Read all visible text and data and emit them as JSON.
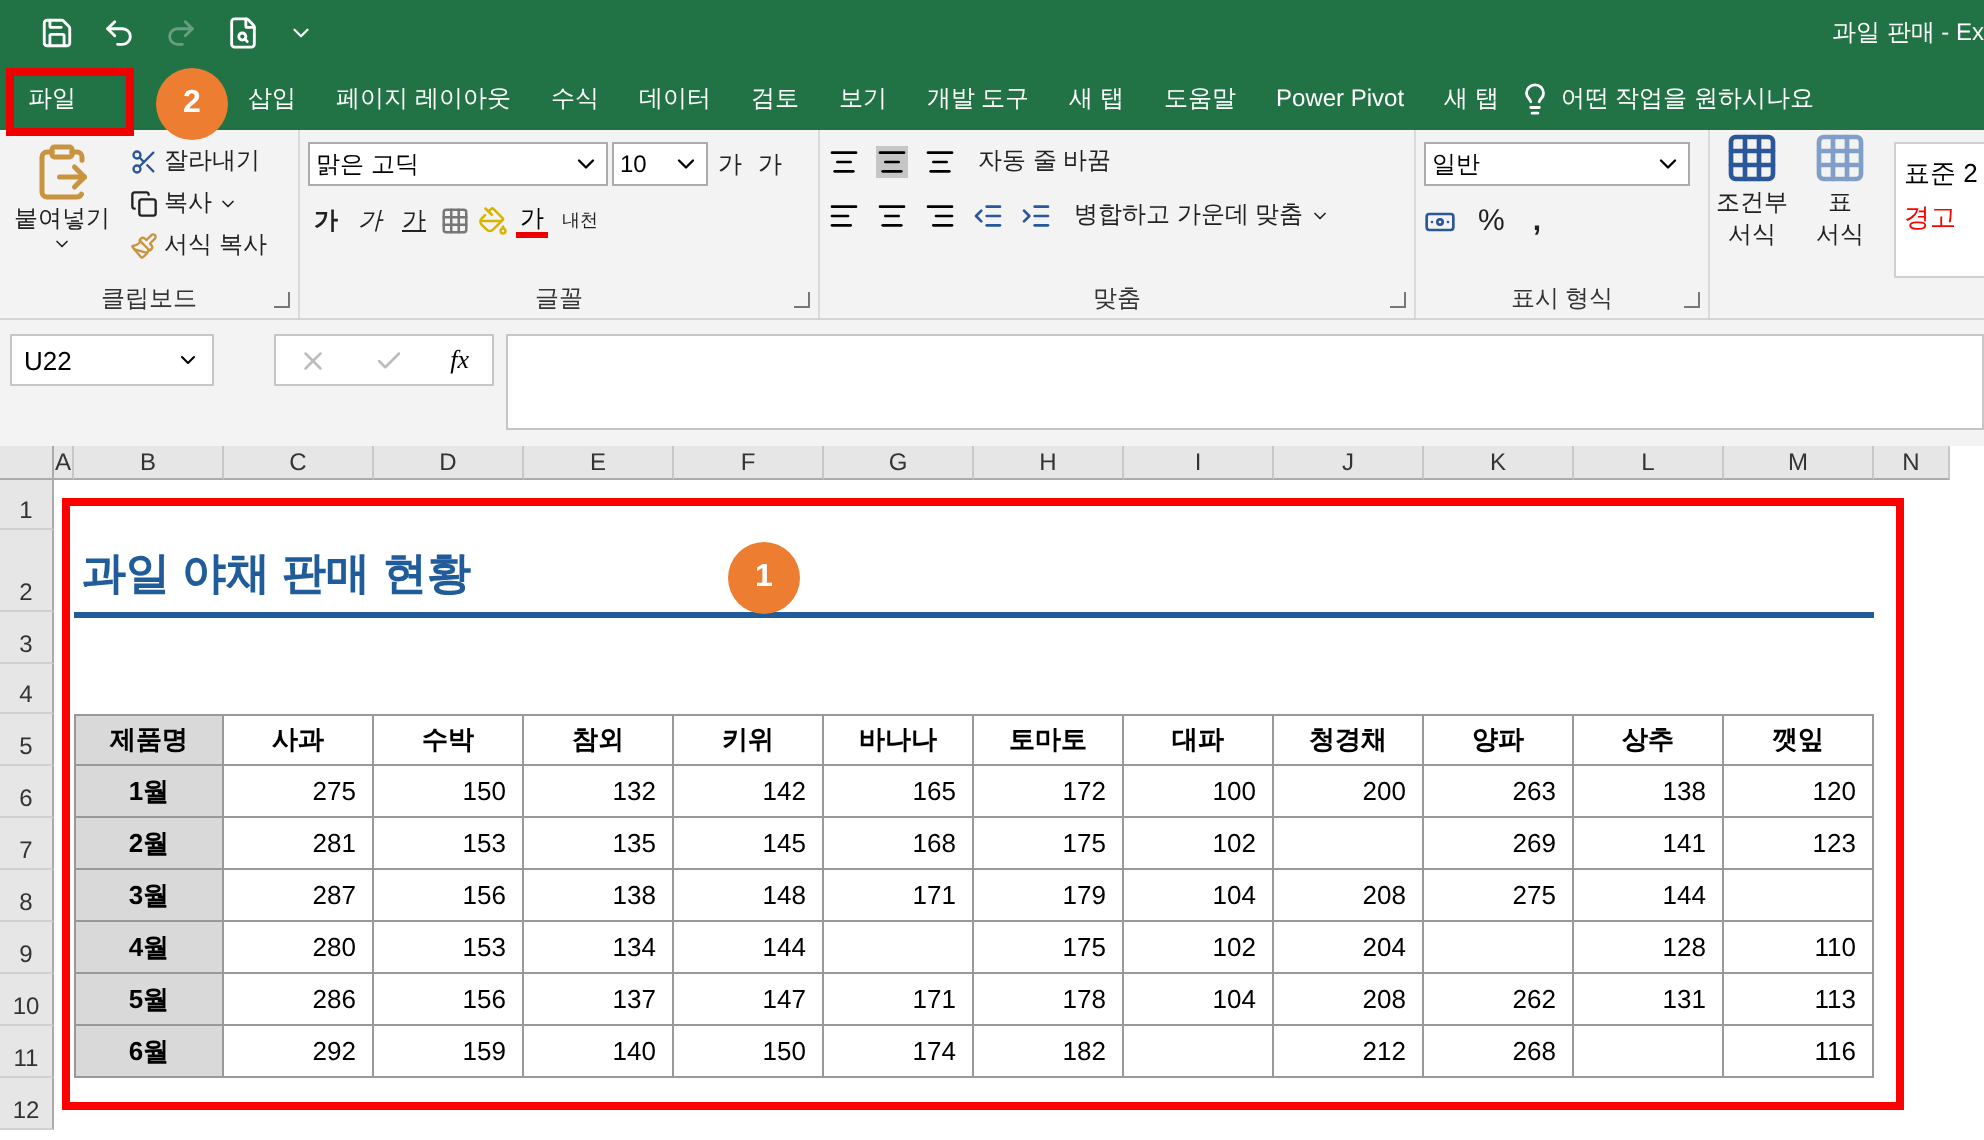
{
  "window": {
    "title": "과일 판매  -  Ex"
  },
  "ribbon_tabs": [
    {
      "label": "파일"
    },
    {
      "label": "삽입"
    },
    {
      "label": "페이지 레이아웃"
    },
    {
      "label": "수식"
    },
    {
      "label": "데이터"
    },
    {
      "label": "검토"
    },
    {
      "label": "보기"
    },
    {
      "label": "개발 도구"
    },
    {
      "label": "새 탭"
    },
    {
      "label": "도움말"
    },
    {
      "label": "Power Pivot"
    },
    {
      "label": "새 탭"
    }
  ],
  "tell_me": "어떤 작업을 원하시나요",
  "clipboard": {
    "paste": "붙여넣기",
    "cut": "잘라내기",
    "copy": "복사",
    "format_painter": "서식 복사",
    "label": "클립보드"
  },
  "font": {
    "font_name": "맑은 고딕",
    "font_size": "10",
    "grow": "가",
    "shrink": "가",
    "bold": "가",
    "italic": "가",
    "underline": "가",
    "font_color": "가",
    "phonetic": "내천",
    "label": "글꼴"
  },
  "alignment": {
    "wrap_text": "자동 줄 바꿈",
    "merge": "병합하고 가운데 맞춤",
    "label": "맞춤"
  },
  "number": {
    "format": "일반",
    "percent": "%",
    "comma": ",",
    "label": "표시 형식"
  },
  "styles": {
    "conditional": [
      "조건부",
      "서식"
    ],
    "table_format": [
      "표",
      "서식"
    ],
    "cell_styles": [
      {
        "label": "표준 2",
        "color": "#000000"
      },
      {
        "label": "경고",
        "color": "#ff0000"
      }
    ]
  },
  "formula_bar": {
    "name_box": "U22",
    "fx": "fx"
  },
  "columns": [
    "A",
    "B",
    "C",
    "D",
    "E",
    "F",
    "G",
    "H",
    "I",
    "J",
    "K",
    "L",
    "M",
    "N"
  ],
  "rows": [
    "1",
    "2",
    "3",
    "4",
    "5",
    "6",
    "7",
    "8",
    "9",
    "10",
    "11",
    "12"
  ],
  "sheet_title": "과일 야채 판매 현황",
  "table": {
    "header": [
      "제품명",
      "사과",
      "수박",
      "참외",
      "키위",
      "바나나",
      "토마토",
      "대파",
      "청경채",
      "양파",
      "상추",
      "깻잎"
    ],
    "rows": [
      [
        "1월",
        "275",
        "150",
        "132",
        "142",
        "165",
        "172",
        "100",
        "200",
        "263",
        "138",
        "120"
      ],
      [
        "2월",
        "281",
        "153",
        "135",
        "145",
        "168",
        "175",
        "102",
        null,
        "269",
        "141",
        "123"
      ],
      [
        "3월",
        "287",
        "156",
        "138",
        "148",
        "171",
        "179",
        "104",
        "208",
        "275",
        "144",
        null
      ],
      [
        "4월",
        "280",
        "153",
        "134",
        "144",
        null,
        "175",
        "102",
        "204",
        null,
        "128",
        "110"
      ],
      [
        "5월",
        "286",
        "156",
        "137",
        "147",
        "171",
        "178",
        "104",
        "208",
        "262",
        "131",
        "113"
      ],
      [
        "6월",
        "292",
        "159",
        "140",
        "150",
        "174",
        "182",
        null,
        "212",
        "268",
        null,
        "116"
      ]
    ]
  },
  "callouts": [
    {
      "label": "1",
      "color": "#ed7d31"
    },
    {
      "label": "2",
      "color": "#ed7d31"
    }
  ]
}
